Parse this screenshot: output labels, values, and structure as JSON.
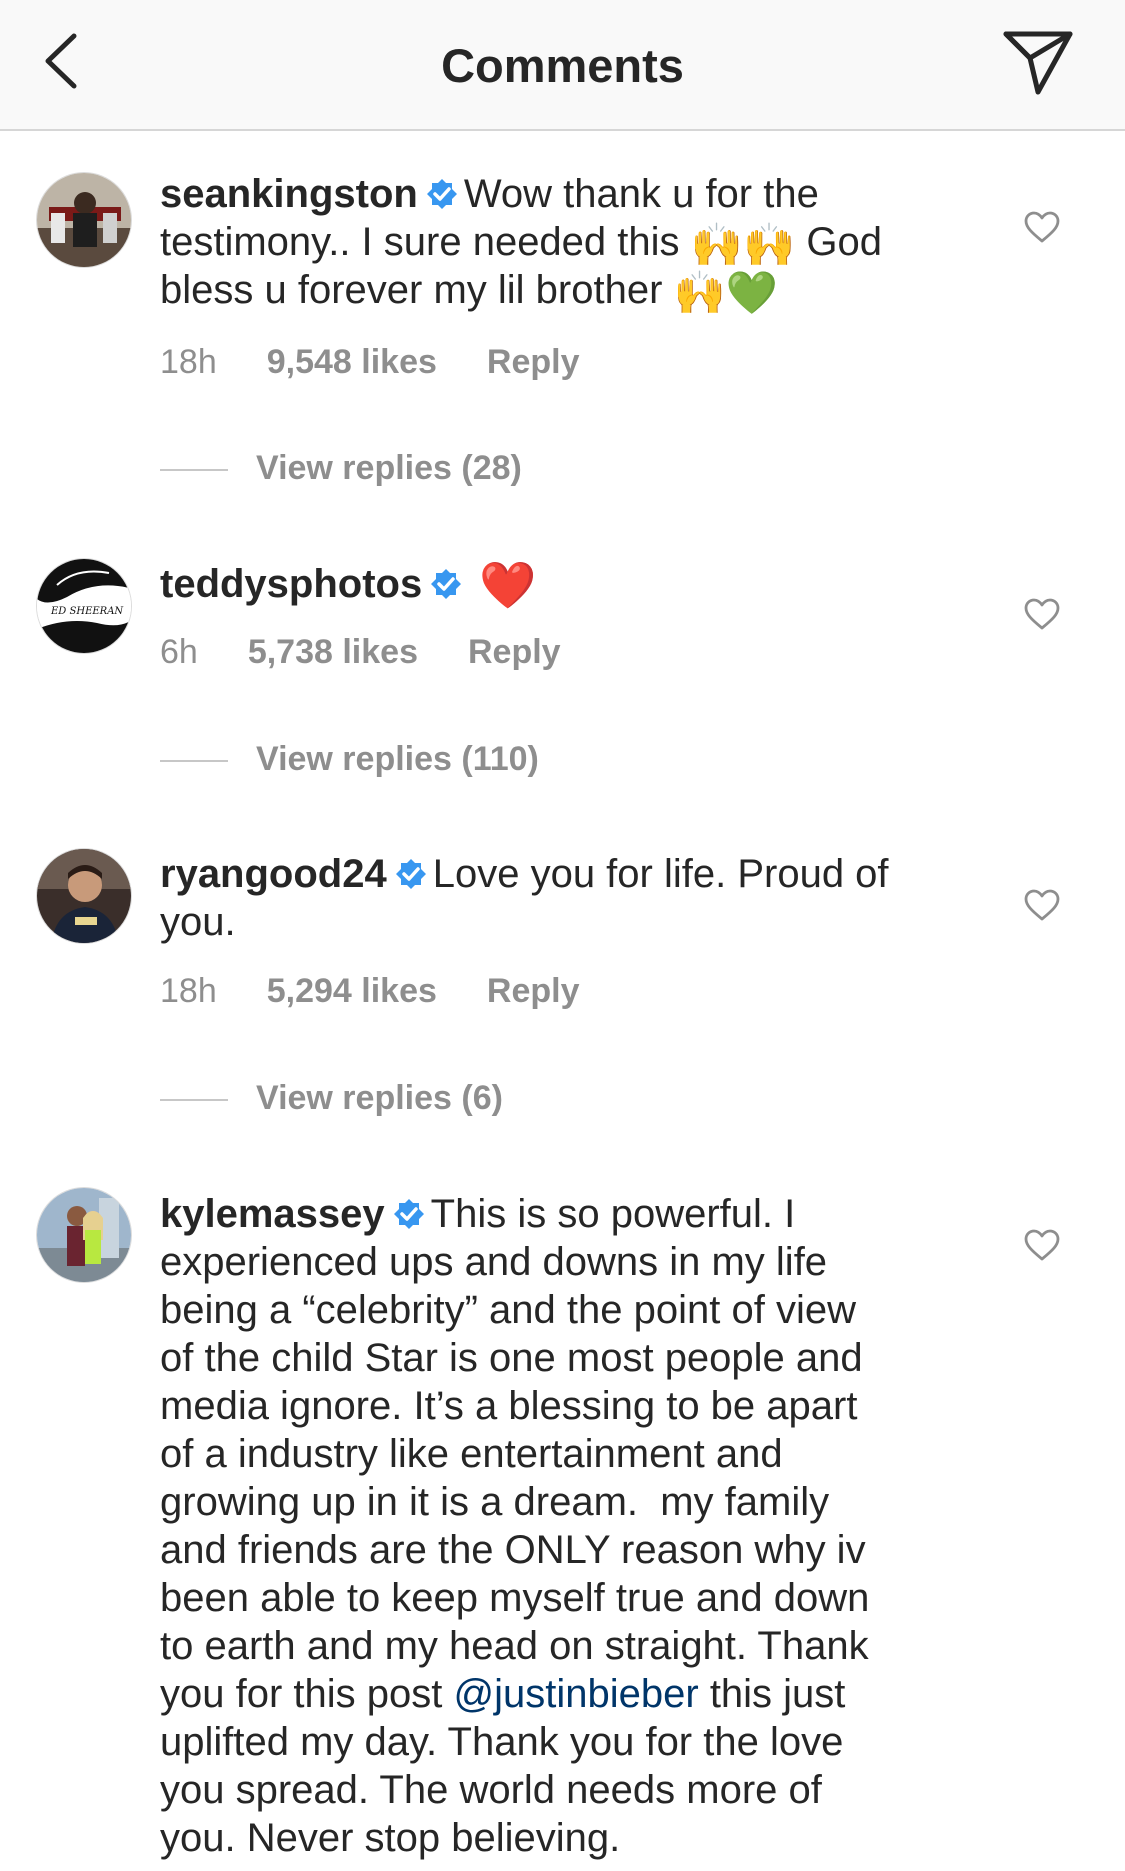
{
  "header": {
    "title": "Comments",
    "back_icon": "chevron-left-icon",
    "share_icon": "paper-plane-icon"
  },
  "colors": {
    "header_bg": "#f9f9f9",
    "text": "#262626",
    "muted": "#8e8e8e",
    "verified_blue": "#3897f0",
    "mention": "#003569"
  },
  "comments": [
    {
      "username": "seankingston",
      "text_lines": [
        "Wow thank u for the",
        "testimony.. I sure needed this",
        "God",
        "bless u forever my lil brother"
      ],
      "emojis": [
        "🙌",
        "🙌",
        "🙌",
        "💚"
      ],
      "time": "18h",
      "likes": "9,548 likes",
      "reply": "Reply",
      "view_replies": "View replies (28)"
    },
    {
      "username": "teddysphotos",
      "text_lines": [],
      "emojis": [
        "❤️"
      ],
      "time": "6h",
      "likes": "5,738 likes",
      "reply": "Reply",
      "view_replies": "View replies (110)",
      "avatar_text": "ED SHEERAN"
    },
    {
      "username": "ryangood24",
      "text_lines": [
        "Love you for life. Proud of",
        "you."
      ],
      "time": "18h",
      "likes": "5,294 likes",
      "reply": "Reply",
      "view_replies": "View replies (6)"
    },
    {
      "username": "kylemassey",
      "text_lines": [
        "This is so powerful. I",
        "experienced ups and downs in my life",
        "being a “celebrity” and the point of view",
        "of the child Star is one most people and",
        "media ignore. It’s a blessing to be apart",
        "of a industry like entertainment and",
        "growing up in it is a dream.  my family",
        "and friends are the ONLY reason why iv",
        "been able to keep myself true and down",
        "to earth and my head on straight. Thank",
        "you for this post",
        "@justinbieber",
        "this just",
        "uplifted my day. Thank you for the love",
        "you spread. The world needs more of",
        "you. Never stop believing."
      ]
    }
  ]
}
